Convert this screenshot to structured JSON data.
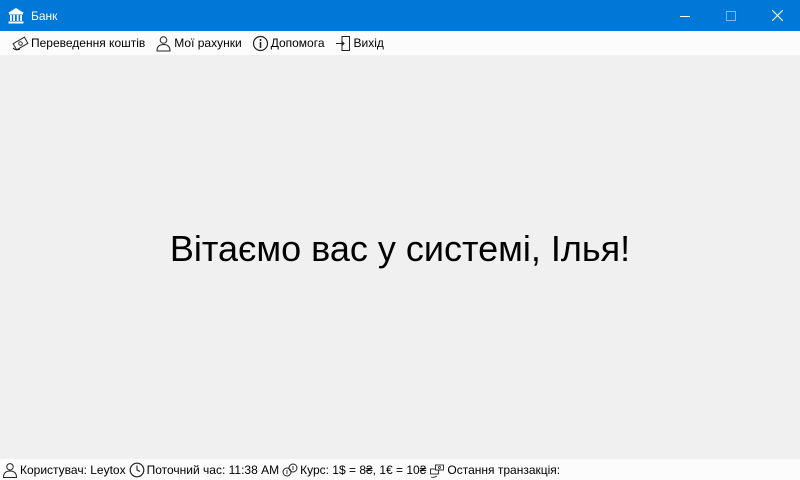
{
  "window": {
    "title": "Банк",
    "icon": "bank-icon",
    "accent_color": "#0078d7"
  },
  "menu": {
    "items": [
      {
        "label": "Переведення коштів",
        "icon": "money-transfer-icon"
      },
      {
        "label": "Мої рахунки",
        "icon": "user-icon"
      },
      {
        "label": "Допомога",
        "icon": "info-icon"
      },
      {
        "label": "Вихід",
        "icon": "exit-door-icon"
      }
    ]
  },
  "main": {
    "welcome": "Вітаємо вас у системі, Ілья!"
  },
  "status": {
    "user": "Користувач: Leytox",
    "time": "Поточний час: 11:38 AM",
    "rate": "Курс: 1$ = 8₴, 1€ = 10₴",
    "last_transaction": "Остання транзакція:"
  }
}
